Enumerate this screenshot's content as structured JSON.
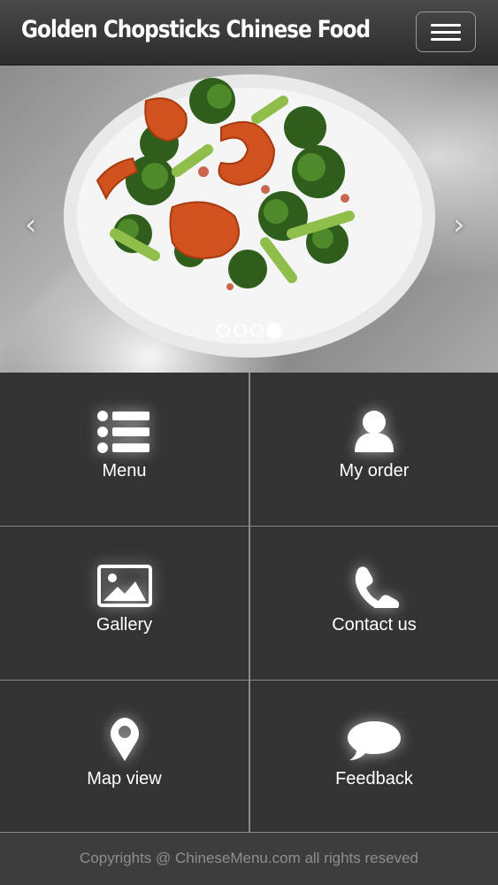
{
  "header": {
    "title": "Golden Chopsticks Chinese Food",
    "menu_toggle_icon": "hamburger-icon"
  },
  "carousel": {
    "prev_arrow": "‹",
    "next_arrow": "›",
    "slide_count": 4,
    "active_slide": 4,
    "image_description_icon": "food-photo"
  },
  "tiles": [
    {
      "label": "Menu",
      "icon": "list-icon"
    },
    {
      "label": "My order",
      "icon": "user-icon"
    },
    {
      "label": "Gallery",
      "icon": "image-icon"
    },
    {
      "label": "Contact us",
      "icon": "phone-icon"
    },
    {
      "label": "Map view",
      "icon": "map-pin-icon"
    },
    {
      "label": "Feedback",
      "icon": "speech-bubble-icon"
    }
  ],
  "footer": {
    "text": "Copyrights @ ChineseMenu.com all rights reseved"
  },
  "colors": {
    "header_bg": "#3a3a3a",
    "tile_bg": "#333333",
    "divider": "#8a8a8a",
    "text": "#ffffff",
    "footer_text": "#8e8e8e"
  }
}
